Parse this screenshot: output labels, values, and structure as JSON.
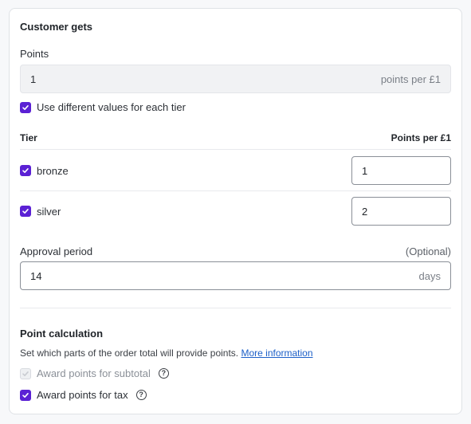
{
  "section_title": "Customer gets",
  "points": {
    "label": "Points",
    "value": "1",
    "suffix": "points per £1"
  },
  "tier_toggle": {
    "label": "Use different values for each tier",
    "checked": true
  },
  "tiers": {
    "header_tier": "Tier",
    "header_points": "Points per £1",
    "rows": [
      {
        "name": "bronze",
        "checked": true,
        "value": "1"
      },
      {
        "name": "silver",
        "checked": true,
        "value": "2"
      }
    ]
  },
  "approval": {
    "label": "Approval period",
    "optional": "(Optional)",
    "value": "14",
    "suffix": "days"
  },
  "point_calculation": {
    "title": "Point calculation",
    "description": "Set which parts of the order total will provide points.",
    "link": "More information",
    "options": [
      {
        "label": "Award points for subtotal",
        "checked": true,
        "disabled": true
      },
      {
        "label": "Award points for tax",
        "checked": true,
        "disabled": false
      }
    ]
  },
  "colors": {
    "accent": "#5b21d4",
    "link": "#1c5fc8"
  }
}
